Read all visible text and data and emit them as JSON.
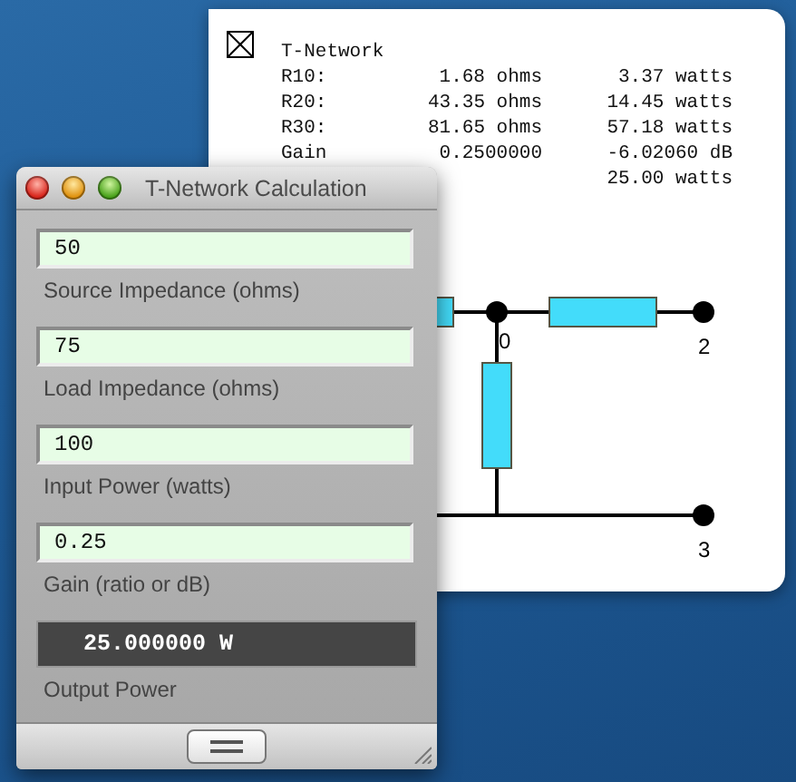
{
  "report_window": {
    "title": "T-Network",
    "rows": [
      {
        "label": "R10:",
        "value": "1.68 ohms",
        "power": "3.37 watts"
      },
      {
        "label": "R20:",
        "value": "43.35 ohms",
        "power": "14.45 watts"
      },
      {
        "label": "R30:",
        "value": "81.65 ohms",
        "power": "57.18 watts"
      },
      {
        "label": "Gain",
        "value": "0.2500000",
        "power": "-6.02060 dB"
      },
      {
        "power": "25.00 watts"
      }
    ],
    "circuit": {
      "node_labels": [
        "0",
        "2",
        "3"
      ]
    }
  },
  "calc_window": {
    "title": "T-Network Calculation",
    "fields": [
      {
        "value": "50",
        "label": "Source Impedance (ohms)"
      },
      {
        "value": "75",
        "label": "Load Impedance (ohms)"
      },
      {
        "value": "100",
        "label": "Input Power (watts)"
      },
      {
        "value": "0.25",
        "label": "Gain (ratio or dB)"
      }
    ],
    "output": {
      "value": "25.000000 W",
      "label": "Output Power"
    }
  }
}
